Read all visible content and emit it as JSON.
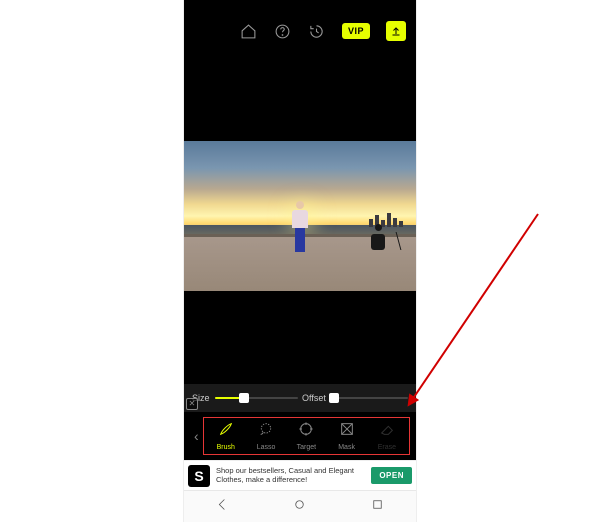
{
  "topbar": {
    "vip_label": "VIP"
  },
  "sliders": {
    "size_label": "Size",
    "size_pct": 35,
    "offset_label": "Offset",
    "offset_pct": 4
  },
  "tools": [
    {
      "id": "brush",
      "label": "Brush",
      "active": true,
      "disabled": false
    },
    {
      "id": "lasso",
      "label": "Lasso",
      "active": false,
      "disabled": false
    },
    {
      "id": "target",
      "label": "Target",
      "active": false,
      "disabled": false
    },
    {
      "id": "mask",
      "label": "Mask",
      "active": false,
      "disabled": false
    },
    {
      "id": "erase",
      "label": "Erase",
      "active": false,
      "disabled": true
    }
  ],
  "ad": {
    "logo_letter": "S",
    "text": "Shop our bestsellers, Casual and Elegant Clothes, make a difference!",
    "cta": "OPEN"
  }
}
